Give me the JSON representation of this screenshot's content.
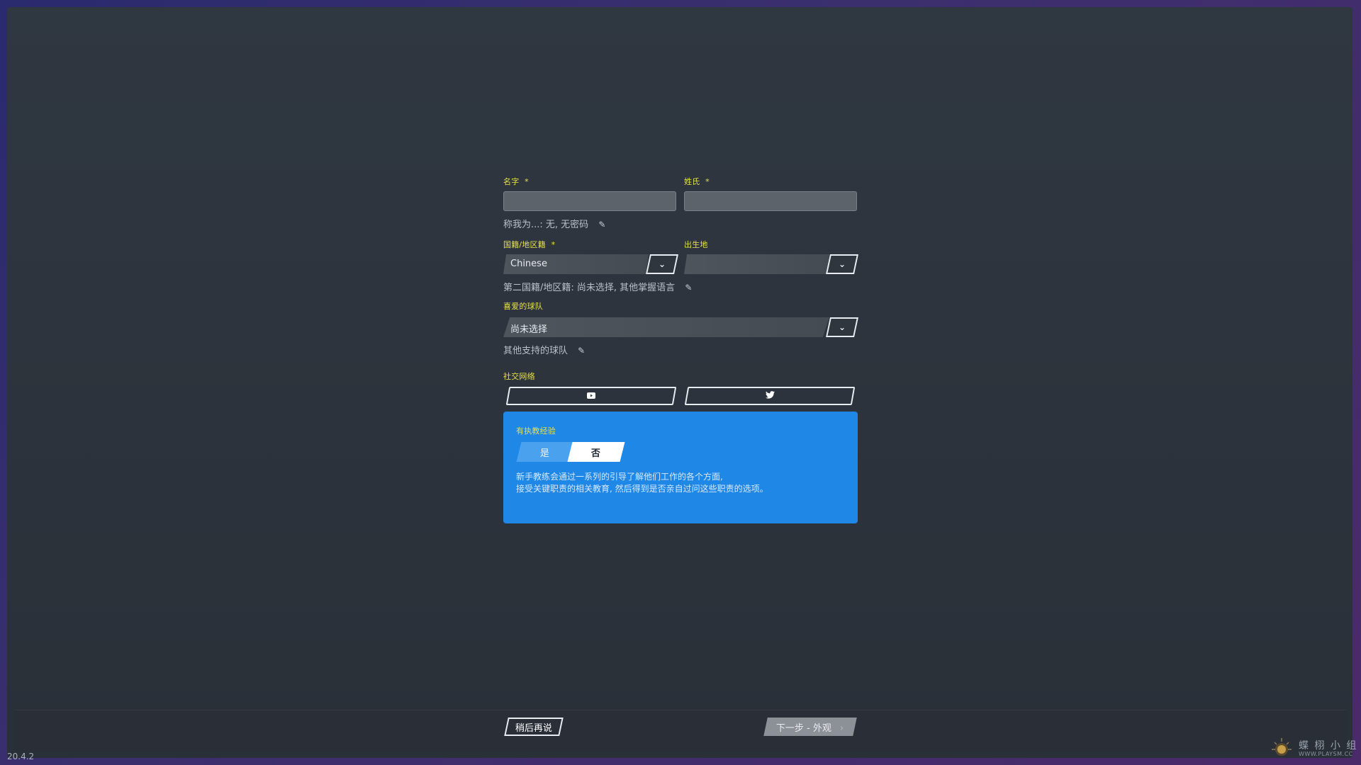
{
  "form": {
    "first_name": {
      "label": "名字",
      "required": "*",
      "value": ""
    },
    "last_name": {
      "label": "姓氏",
      "required": "*",
      "value": ""
    },
    "nickname_hint": "称我为...: 无, 无密码",
    "nationality": {
      "label": "国籍/地区籍",
      "required": "*",
      "value": "Chinese"
    },
    "birthplace": {
      "label": "出生地",
      "value": ""
    },
    "second_nationality_hint": "第二国籍/地区籍: 尚未选择, 其他掌握语言",
    "favorite_team": {
      "label": "喜爱的球队",
      "value": "尚未选择"
    },
    "other_teams_hint": "其他支持的球队",
    "social": {
      "label": "社交网络",
      "youtube_icon": "youtube-icon",
      "twitter_icon": "twitter-icon"
    },
    "coaching": {
      "label": "有执教经验",
      "yes": "是",
      "no": "否",
      "selected": "否",
      "desc_line1": "新手教练会通过一系列的引导了解他们工作的各个方面,",
      "desc_line2": "接受关键职责的相关教育, 然后得到是否亲自过问这些职责的选项。"
    }
  },
  "footer": {
    "later_button": "稍后再说",
    "next_button": "下一步 - 外观",
    "version": "20.4.2"
  },
  "watermark": {
    "title": "蝶 栩 小 组",
    "subtitle": "WWW.PLAYSM.CC"
  },
  "colors": {
    "accent_yellow": "#e6e04a",
    "coaching_blue": "#1f87e6",
    "background": "#2f3741"
  }
}
